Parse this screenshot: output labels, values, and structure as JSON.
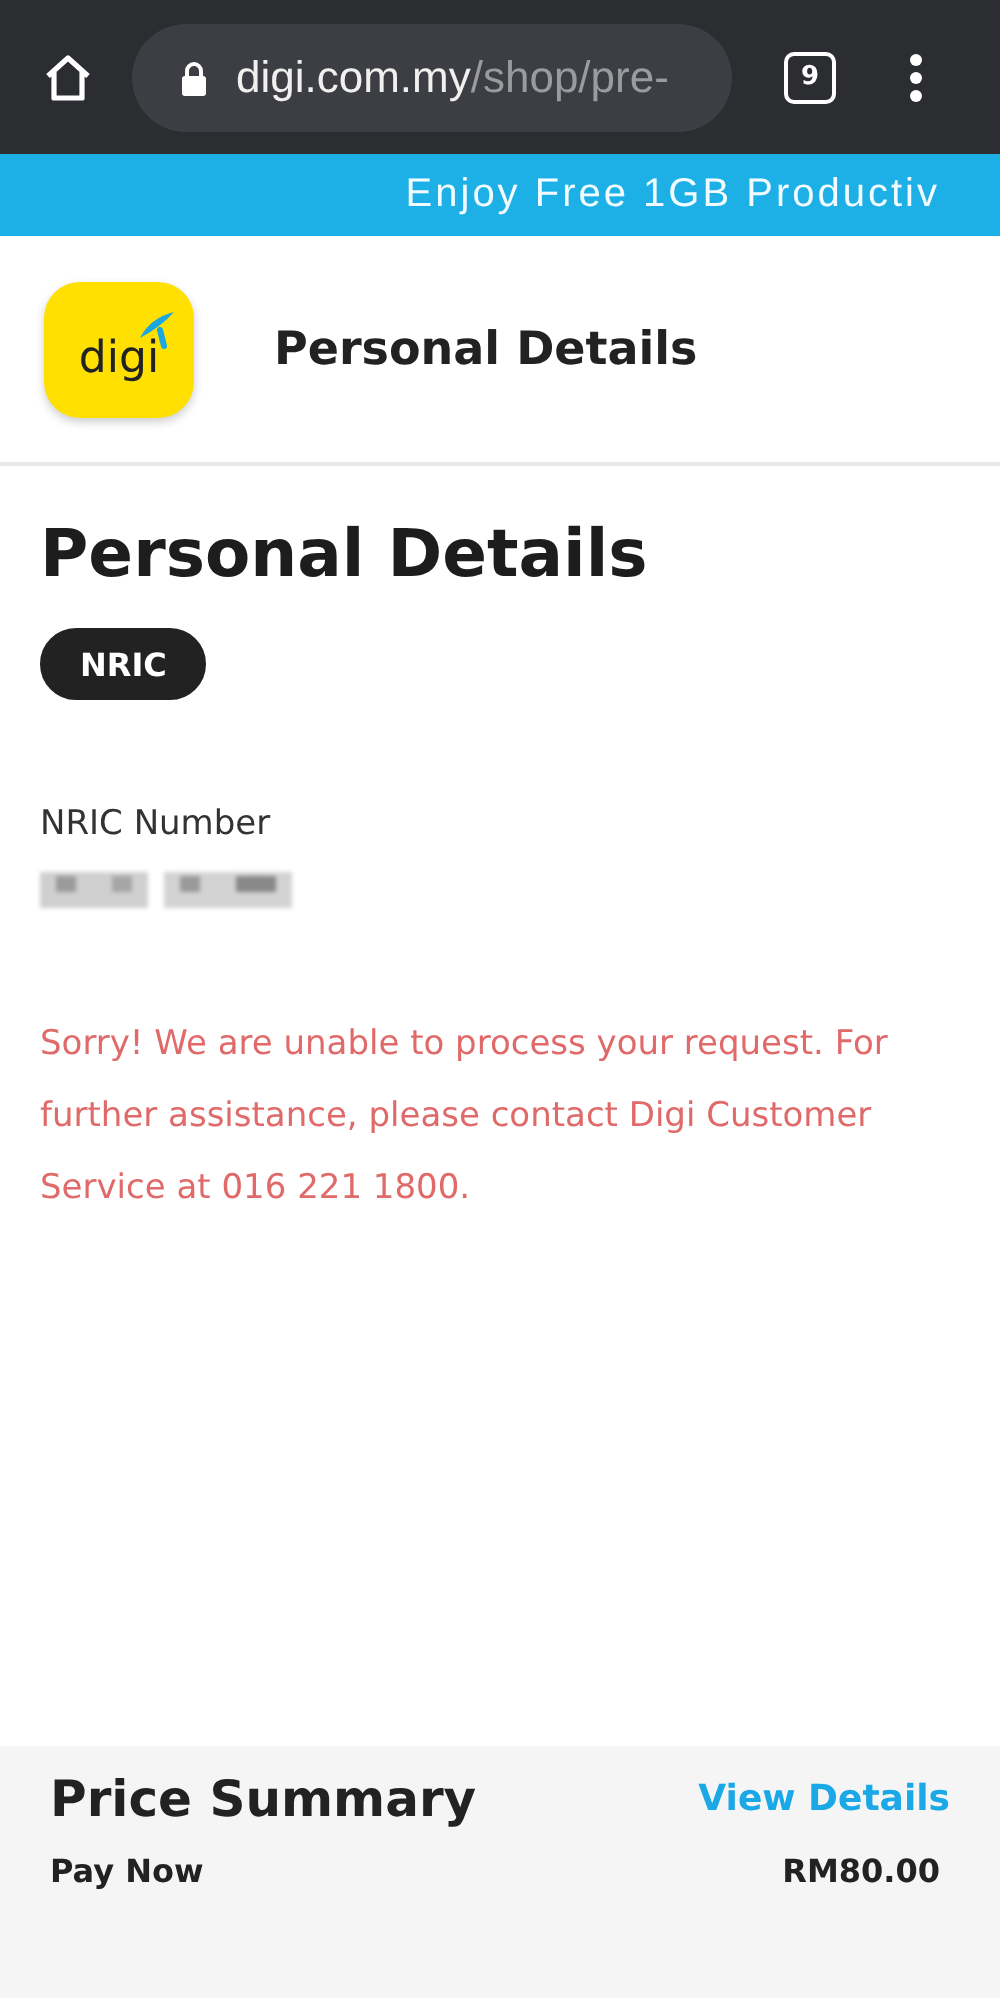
{
  "browser": {
    "url_host": "digi.com.my",
    "url_path": "/shop/pre-",
    "tab_count": "9"
  },
  "banner": {
    "text": "Enjoy Free 1GB Productiv"
  },
  "header": {
    "logo_text": "digi",
    "title": "Personal Details"
  },
  "form": {
    "heading": "Personal Details",
    "id_types": [
      {
        "label": "NRIC",
        "selected": true
      }
    ],
    "field_label": "NRIC Number",
    "error": "Sorry! We are unable to process your request. For further assistance, please contact Digi Customer Service at 016 221 1800."
  },
  "summary": {
    "title": "Price Summary",
    "link": "View Details",
    "rows": [
      {
        "label": "Pay Now",
        "value": "RM80.00"
      }
    ]
  }
}
